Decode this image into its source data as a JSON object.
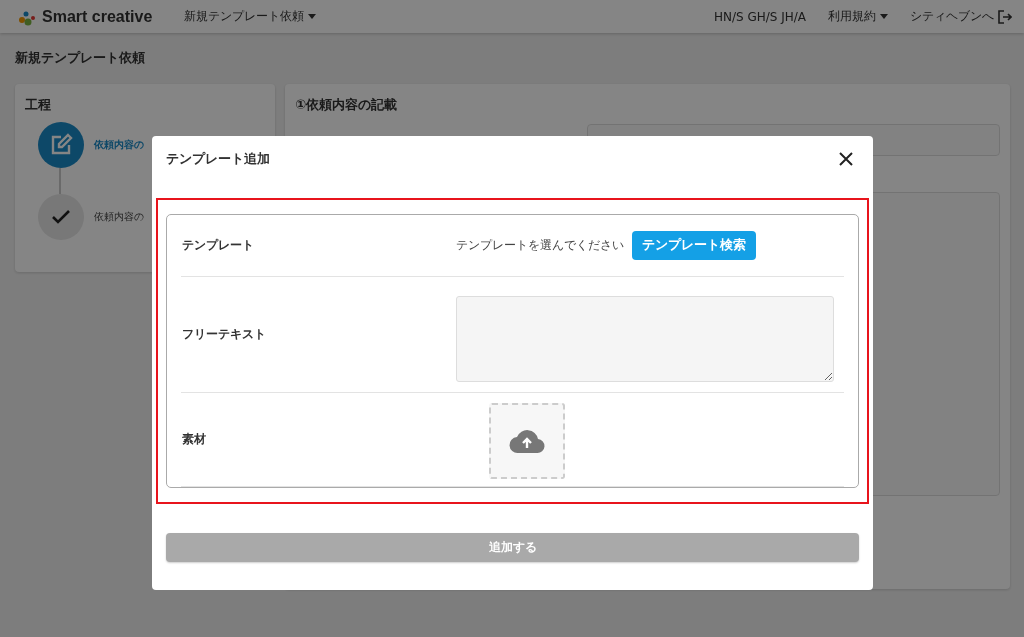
{
  "header": {
    "logo": "Smart creative",
    "nav": [
      {
        "label": "新規テンプレート依頼",
        "dropdown": true
      },
      {
        "label": "HN/S GH/S JH/A",
        "dropdown": false
      },
      {
        "label": "利用規約",
        "dropdown": true
      },
      {
        "label": "シティヘブンへ",
        "dropdown": false
      }
    ]
  },
  "page_title": "新規テンプレート依頼",
  "steps_panel": {
    "title": "工程",
    "steps": [
      {
        "label": "依頼内容の",
        "selected": true
      },
      {
        "label": "依頼内容の",
        "selected": false
      }
    ]
  },
  "form_panel": {
    "title": "①依頼内容の記載"
  },
  "modal": {
    "title": "テンプレート追加",
    "rows": [
      {
        "kind": "picker",
        "label": "テンプレート",
        "hint": "テンプレートを選んでください",
        "button": "テンプレート検索"
      },
      {
        "kind": "textarea",
        "label": "フリーテキスト"
      },
      {
        "kind": "upload",
        "label": "素材"
      }
    ],
    "submit": {
      "label": "追加する",
      "disabled": true
    }
  }
}
